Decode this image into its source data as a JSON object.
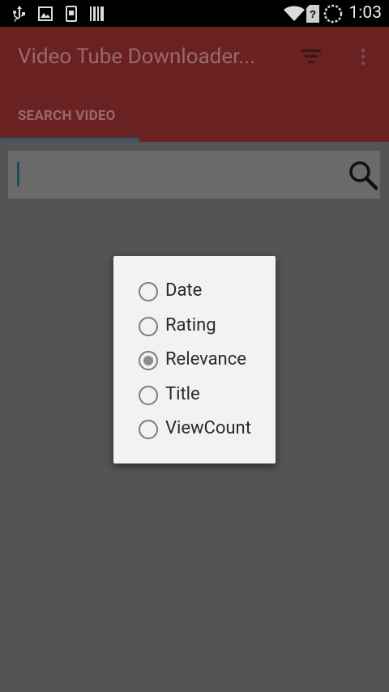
{
  "status_bar": {
    "time": "1:03",
    "icons": [
      "usb-icon",
      "image-icon",
      "sim-card-icon",
      "barcode-icon",
      "wifi-icon",
      "no-sim-icon",
      "battery-loading-icon"
    ]
  },
  "app_bar": {
    "title": "Video Tube Downloader...",
    "filter_icon": "filter-icon",
    "more_icon": "more-vert-icon",
    "tabs": [
      {
        "label": "SEARCH VIDEO"
      }
    ]
  },
  "search": {
    "placeholder": "",
    "value": "",
    "icon": "search-icon"
  },
  "sort_dialog": {
    "options": [
      {
        "label": "Date",
        "checked": false
      },
      {
        "label": "Rating",
        "checked": false
      },
      {
        "label": "Relevance",
        "checked": true
      },
      {
        "label": "Title",
        "checked": false
      },
      {
        "label": "ViewCount",
        "checked": false
      }
    ]
  },
  "colors": {
    "app_bar": "#6a2121",
    "scrim": "#545454",
    "dialog": "#f2f2f2"
  }
}
